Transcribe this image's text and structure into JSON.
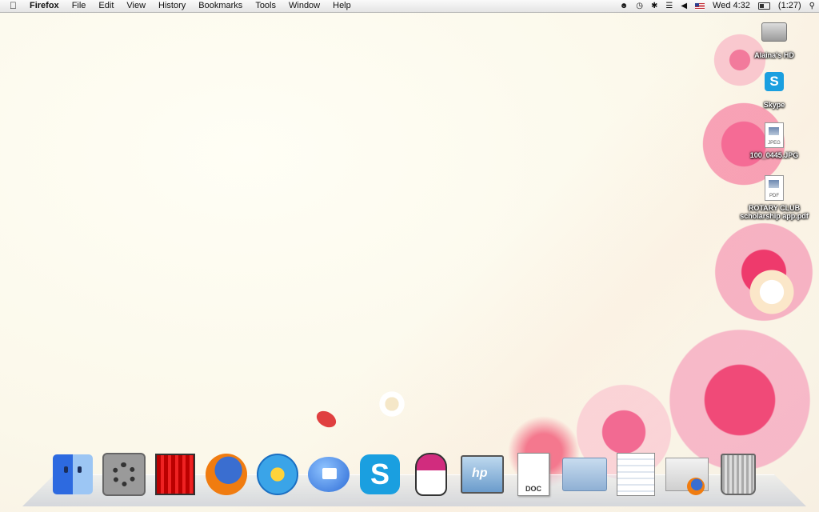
{
  "menubar": {
    "app_name": "Firefox",
    "menus": [
      "File",
      "Edit",
      "View",
      "History",
      "Bookmarks",
      "Tools",
      "Window",
      "Help"
    ],
    "clock": "Wed 4:32",
    "battery": "(1:27)",
    "status_icons": [
      "time-machine-icon",
      "bluetooth-icon",
      "wifi-icon",
      "volume-icon",
      "input-flag-icon",
      "battery-icon",
      "spotlight-icon"
    ]
  },
  "desktop": {
    "icons": [
      {
        "label": "Alaina's HD",
        "icon": "hard-drive-icon"
      },
      {
        "label": "Skype",
        "icon": "skype-icon"
      },
      {
        "label": "100_0445.JPG",
        "icon": "jpeg-file-icon",
        "type": "JPEG"
      },
      {
        "label": "ROTARY CLUB scholarship app.pdf",
        "icon": "pdf-file-icon",
        "type": "PDF"
      }
    ]
  },
  "dock": {
    "items": [
      {
        "name": "Finder",
        "icon": "finder-icon"
      },
      {
        "name": "System Preferences",
        "icon": "system-preferences-icon"
      },
      {
        "name": "Photo Booth",
        "icon": "photo-booth-icon"
      },
      {
        "name": "Firefox",
        "icon": "firefox-icon"
      },
      {
        "name": "iTunes",
        "icon": "itunes-icon"
      },
      {
        "name": "iChat",
        "icon": "ichat-icon"
      },
      {
        "name": "Skype",
        "icon": "skype-icon"
      },
      {
        "name": "Penguin app",
        "icon": "penguin-icon"
      },
      {
        "name": "HP",
        "icon": "hp-icon"
      },
      {
        "name": "Document",
        "icon": "doc-icon",
        "badge": "DOC"
      },
      {
        "name": "Applications folder",
        "icon": "folder-icon"
      },
      {
        "name": "Documents stack",
        "icon": "documents-stack-icon"
      },
      {
        "name": "Downloads stack",
        "icon": "downloads-stack-icon"
      },
      {
        "name": "Trash",
        "icon": "trash-icon"
      }
    ]
  },
  "colors": {
    "flower_pink": "#f0467a",
    "flower_light": "#f9b6c8",
    "accent_blue": "#1a9fe0"
  }
}
